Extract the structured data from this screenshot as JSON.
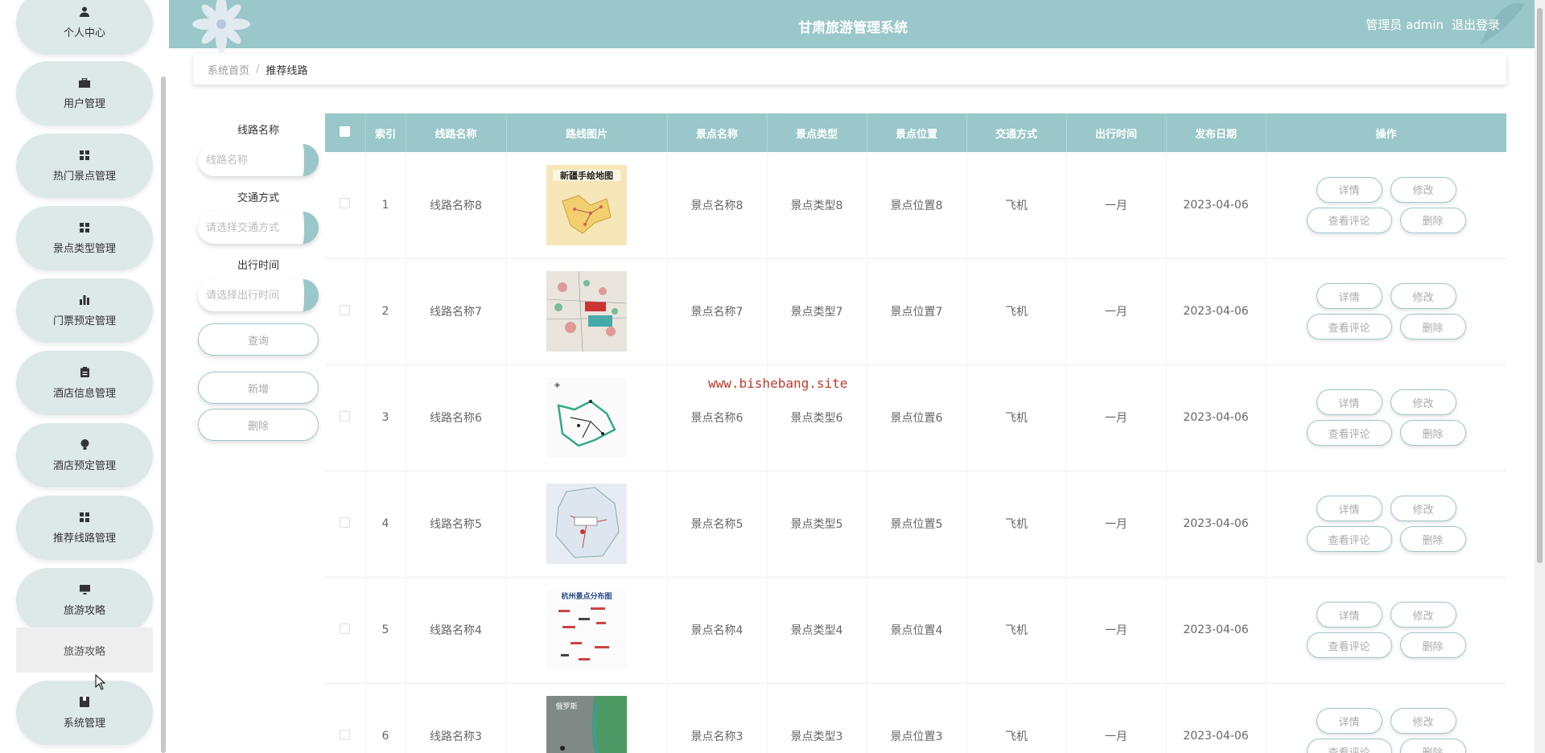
{
  "header": {
    "title": "甘肃旅游管理系统",
    "user_label": "管理员 admin",
    "logout": "退出登录"
  },
  "sidebar": {
    "items": [
      {
        "label": "个人中心",
        "icon": "person-icon"
      },
      {
        "label": "用户管理",
        "icon": "briefcase-icon"
      },
      {
        "label": "热门景点管理",
        "icon": "grid-icon"
      },
      {
        "label": "景点类型管理",
        "icon": "grid-icon"
      },
      {
        "label": "门票预定管理",
        "icon": "bar-chart-icon"
      },
      {
        "label": "酒店信息管理",
        "icon": "clipboard-icon"
      },
      {
        "label": "酒店预定管理",
        "icon": "bulb-icon"
      },
      {
        "label": "推荐线路管理",
        "icon": "grid-icon"
      },
      {
        "label": "旅游攻略",
        "icon": "monitor-icon"
      },
      {
        "label": "系统管理",
        "icon": "book-icon"
      }
    ],
    "sub_item": "旅游攻略"
  },
  "breadcrumb": {
    "home": "系统首页",
    "separator": "/",
    "current": "推荐线路"
  },
  "search": {
    "route_name_label": "线路名称",
    "route_name_placeholder": "线路名称",
    "transport_label": "交通方式",
    "transport_placeholder": "请选择交通方式",
    "time_label": "出行时间",
    "time_placeholder": "请选择出行时间",
    "query_button": "查询",
    "add_button": "新增",
    "delete_button": "删除"
  },
  "table": {
    "headers": [
      "索引",
      "线路名称",
      "路线图片",
      "景点名称",
      "景点类型",
      "景点位置",
      "交通方式",
      "出行时间",
      "发布日期",
      "操作"
    ],
    "rows": [
      {
        "index": "1",
        "route": "线路名称8",
        "image": "新疆手绘地图",
        "spot": "景点名称8",
        "type": "景点类型8",
        "location": "景点位置8",
        "transport": "飞机",
        "time": "一月",
        "date": "2023-04-06"
      },
      {
        "index": "2",
        "route": "线路名称7",
        "image": "",
        "spot": "景点名称7",
        "type": "景点类型7",
        "location": "景点位置7",
        "transport": "飞机",
        "time": "一月",
        "date": "2023-04-06"
      },
      {
        "index": "3",
        "route": "线路名称6",
        "image": "",
        "spot": "景点名称6",
        "type": "景点类型6",
        "location": "景点位置6",
        "transport": "飞机",
        "time": "一月",
        "date": "2023-04-06"
      },
      {
        "index": "4",
        "route": "线路名称5",
        "image": "",
        "spot": "景点名称5",
        "type": "景点类型5",
        "location": "景点位置5",
        "transport": "飞机",
        "time": "一月",
        "date": "2023-04-06"
      },
      {
        "index": "5",
        "route": "线路名称4",
        "image": "杭州景点分布图",
        "spot": "景点名称4",
        "type": "景点类型4",
        "location": "景点位置4",
        "transport": "飞机",
        "time": "一月",
        "date": "2023-04-06"
      },
      {
        "index": "6",
        "route": "线路名称3",
        "image": "俄罗斯",
        "spot": "景点名称3",
        "type": "景点类型3",
        "location": "景点位置3",
        "transport": "飞机",
        "time": "一月",
        "date": "2023-04-06"
      }
    ],
    "ops": {
      "detail": "详情",
      "edit": "修改",
      "comments": "查看评论",
      "delete": "删除"
    }
  },
  "watermark": "www.bishebang.site",
  "colors": {
    "accent": "#9ac7c9",
    "watermark": "#c0392b"
  }
}
